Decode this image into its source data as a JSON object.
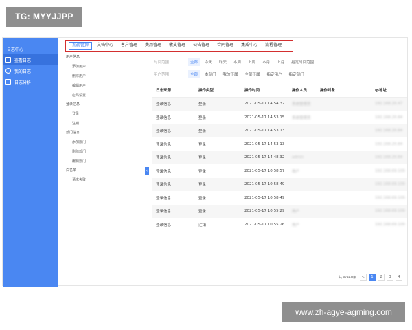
{
  "watermarks": {
    "top_left": "TG: MYYJJPP",
    "bottom_right": "www.zh-agye-agming.com"
  },
  "sidebar": {
    "title": "日志中心",
    "items": [
      {
        "label": "查看日志",
        "icon": "document-icon",
        "active": true
      },
      {
        "label": "我的日志",
        "icon": "user-icon",
        "active": false
      },
      {
        "label": "日志分析",
        "icon": "chart-icon",
        "active": false
      }
    ]
  },
  "top_tabs": [
    "系统管理",
    "文档中心",
    "客户管理",
    "费用管理",
    "收支管理",
    "公告管理",
    "合同管理",
    "集成中心",
    "流程管理"
  ],
  "tree": [
    {
      "group": "用户信息",
      "leaves": [
        "添加用户",
        "删除用户",
        "编辑用户",
        "密码设置"
      ]
    },
    {
      "group": "登录信息",
      "leaves": [
        "登录",
        "注销"
      ]
    },
    {
      "group": "部门信息",
      "leaves": [
        "添加部门",
        "删除部门",
        "编辑部门"
      ]
    },
    {
      "group": "白名单",
      "leaves": [
        "请求失败"
      ]
    }
  ],
  "filters": {
    "time": {
      "label": "时间范围",
      "options": [
        "全部",
        "今天",
        "昨天",
        "本周",
        "上周",
        "本月",
        "上月",
        "指定时间范围"
      ]
    },
    "user": {
      "label": "用户范围",
      "options": [
        "全部",
        "本部门",
        "我的下属",
        "全部下属",
        "指定用户",
        "指定部门"
      ]
    }
  },
  "table": {
    "columns": [
      "日志来源",
      "操作类型",
      "操作时间",
      "操作人员",
      "操作对象",
      "ip地址"
    ],
    "rows": [
      [
        "登录信息",
        "登录",
        "2021-05-17 14:54:32",
        "系统管理员",
        "",
        "192.168.20.47"
      ],
      [
        "登录信息",
        "登录",
        "2021-05-17 14:53:15",
        "系统管理员",
        "",
        "192.168.20.84"
      ],
      [
        "登录信息",
        "登录",
        "2021-05-17 14:53:13",
        "",
        "",
        "192.168.20.84"
      ],
      [
        "登录信息",
        "登录",
        "2021-05-17 14:53:13",
        "",
        "",
        "192.168.20.84"
      ],
      [
        "登录信息",
        "登录",
        "2021-05-17 14:48:32",
        "admin",
        "",
        "192.168.20.84"
      ],
      [
        "登录信息",
        "登录",
        "2021-05-17 10:58:57",
        "用户",
        "",
        "192.168.69.109"
      ],
      [
        "登录信息",
        "登录",
        "2021-05-17 10:58:49",
        "",
        "",
        "192.168.69.109"
      ],
      [
        "登录信息",
        "登录",
        "2021-05-17 10:58:49",
        "",
        "",
        "192.168.69.109"
      ],
      [
        "登录信息",
        "登录",
        "2021-05-17 10:55:29",
        "用户",
        "",
        "192.168.69.109"
      ],
      [
        "登录信息",
        "注销",
        "2021-05-17 10:55:26",
        "用户",
        "",
        "192.168.69.109"
      ]
    ]
  },
  "pager": {
    "info": "共36940条",
    "prev": "<",
    "pages": [
      "1",
      "2",
      "3",
      "4"
    ],
    "active_page": "1"
  },
  "colors": {
    "accent": "#4a87f2",
    "highlight_box": "#d32f2f"
  }
}
